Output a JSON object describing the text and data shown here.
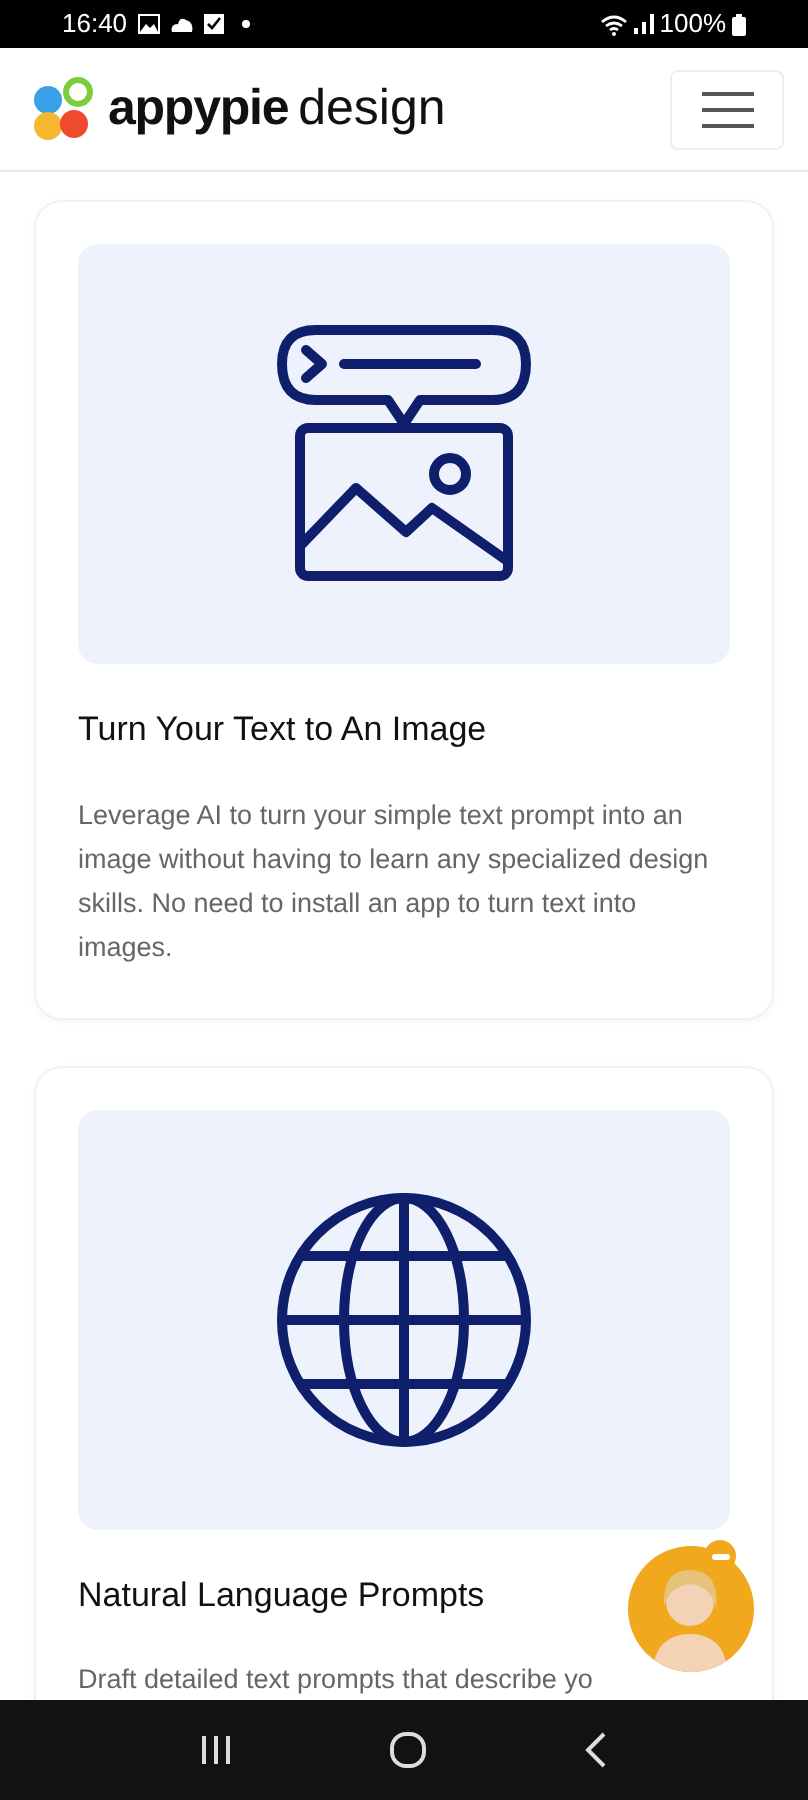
{
  "status_bar": {
    "time": "16:40",
    "battery": "100%"
  },
  "header": {
    "brand": "appypie",
    "brand_suffix": "design"
  },
  "cards": [
    {
      "kind": "text-to-image",
      "title": "Turn Your Text to An Image",
      "description": "Leverage AI to turn your simple text prompt into an image without having to learn any specialized design skills. No need to install an app to turn text into images."
    },
    {
      "kind": "globe",
      "title": "Natural Language Prompts",
      "description": "Draft detailed text prompts that describe yo"
    }
  ]
}
